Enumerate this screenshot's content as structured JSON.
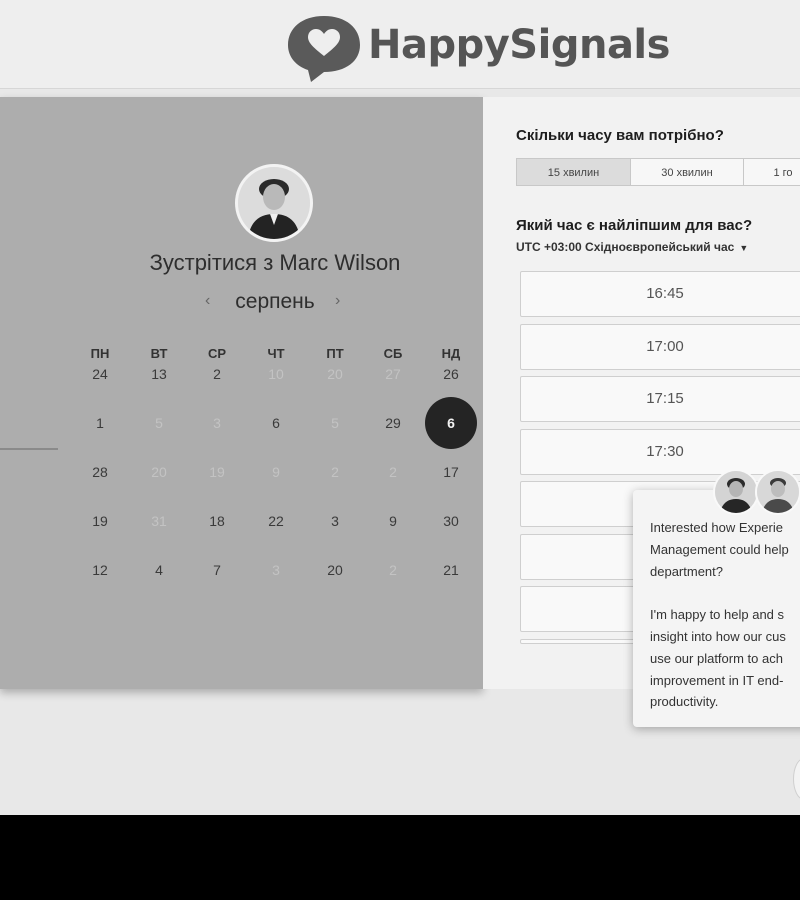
{
  "brand": {
    "name": "HappySignals"
  },
  "calendar": {
    "title": "Зустрітися з Marc Wilson",
    "month": "серпень",
    "weekdays": [
      "ПН",
      "ВТ",
      "СР",
      "ЧТ",
      "ПТ",
      "СБ",
      "НД"
    ],
    "weeks": [
      [
        {
          "d": "24"
        },
        {
          "d": "13"
        },
        {
          "d": "2"
        },
        {
          "d": "10",
          "dim": true
        },
        {
          "d": "20",
          "dim": true
        },
        {
          "d": "27",
          "dim": true
        },
        {
          "d": "26"
        }
      ],
      [
        {
          "d": "1"
        },
        {
          "d": "5",
          "dim": true
        },
        {
          "d": "3",
          "dim": true
        },
        {
          "d": "6"
        },
        {
          "d": "5",
          "dim": true
        },
        {
          "d": "29"
        },
        {
          "d": "6",
          "selected": true
        }
      ],
      [
        {
          "d": "28"
        },
        {
          "d": "20",
          "dim": true
        },
        {
          "d": "19",
          "dim": true
        },
        {
          "d": "9",
          "dim": true
        },
        {
          "d": "2",
          "dim": true
        },
        {
          "d": "2",
          "dim": true
        },
        {
          "d": "17"
        }
      ],
      [
        {
          "d": "19"
        },
        {
          "d": "31",
          "dim": true
        },
        {
          "d": "18"
        },
        {
          "d": "22"
        },
        {
          "d": "3"
        },
        {
          "d": "9"
        },
        {
          "d": "30"
        }
      ],
      [
        {
          "d": "12"
        },
        {
          "d": "4"
        },
        {
          "d": "7"
        },
        {
          "d": "3",
          "dim": true
        },
        {
          "d": "20"
        },
        {
          "d": "2",
          "dim": true
        },
        {
          "d": "21"
        }
      ]
    ]
  },
  "booking": {
    "duration_question": "Скільки часу вам потрібно?",
    "durations": [
      "15 хвилин",
      "30 хвилин",
      "1 го"
    ],
    "active_duration": 0,
    "time_question": "Який час є найліпшим для вас?",
    "timezone": "UTC +03:00 Східноєвропейський час",
    "slots": [
      "16:45",
      "17:00",
      "17:15",
      "17:30",
      "",
      "",
      "",
      ""
    ]
  },
  "chat_popup": {
    "lines_1": [
      "Interested how Experie",
      "Management could help",
      "department?"
    ],
    "lines_2": [
      "I'm happy to help and s",
      "insight into how our cus",
      "use our platform to ach",
      "improvement in IT end-",
      "productivity."
    ]
  }
}
